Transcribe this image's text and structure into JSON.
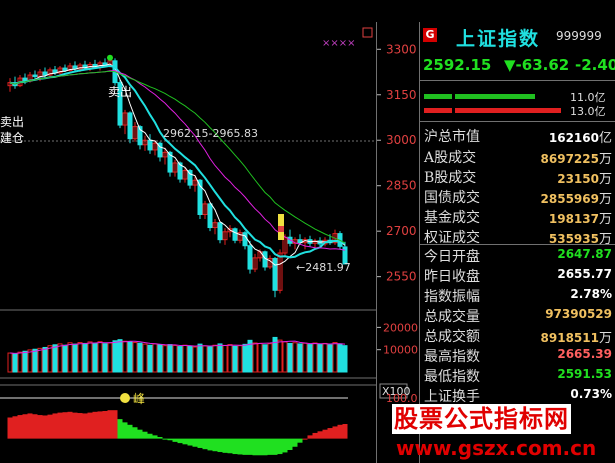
{
  "header": {
    "badge": "G",
    "index_name": "上证指数",
    "index_code": "999999"
  },
  "quote": {
    "last": "2592.15",
    "change": "▼-63.62",
    "change_pct": "-2.40"
  },
  "volume_bars": {
    "upper_label": "11.0亿",
    "lower_label": "13.0亿"
  },
  "stats": [
    {
      "key": "沪总市值",
      "value": "162160",
      "unit": "亿",
      "color": "#ffffff"
    },
    {
      "key": "A股成交",
      "value": "8697225",
      "unit": "万",
      "color": "#f0c060"
    },
    {
      "key": "B股成交",
      "value": "23150",
      "unit": "万",
      "color": "#f0c060"
    },
    {
      "key": "国债成交",
      "value": "2855969",
      "unit": "万",
      "color": "#f0c060"
    },
    {
      "key": "基金成交",
      "value": "198137",
      "unit": "万",
      "color": "#f0c060"
    },
    {
      "key": "权证成交",
      "value": "535935",
      "unit": "万",
      "color": "#f0c060"
    },
    {
      "key": "今日开盘",
      "value": "2647.87",
      "unit": "",
      "color": "#20e020"
    },
    {
      "key": "昨日收盘",
      "value": "2655.77",
      "unit": "",
      "color": "#ffffff"
    },
    {
      "key": "指数振幅",
      "value": "2.78%",
      "unit": "",
      "color": "#ffffff"
    },
    {
      "key": "总成交量",
      "value": "97390529",
      "unit": "",
      "color": "#f0c060"
    },
    {
      "key": "总成交额",
      "value": "8918511",
      "unit": "万",
      "color": "#f0c060"
    },
    {
      "key": "最高指数",
      "value": "2665.39",
      "unit": "",
      "color": "#ff6060"
    },
    {
      "key": "最低指数",
      "value": "2591.53",
      "unit": "",
      "color": "#20e020"
    },
    {
      "key": "上证换手",
      "value": "0.73%",
      "unit": "",
      "color": "#ffffff"
    }
  ],
  "price_axis": {
    "range": [
      2440,
      3390
    ],
    "ticks": [
      "3300",
      "3150",
      "3000",
      "2850",
      "2700",
      "2550"
    ]
  },
  "volume_axis": {
    "ticks": [
      "20000",
      "10000"
    ],
    "multiplier": "X100"
  },
  "indicator_axis": {
    "ticks": [
      "100.0"
    ]
  },
  "annotations": {
    "buy": "建仓",
    "sell": "卖出",
    "range": "2962.15-2965.83",
    "low": "←2481.97",
    "peak": "峰"
  },
  "watermark": {
    "title": "股票公式指标网",
    "url": "www.gszx.com.cn"
  },
  "colors": {
    "up": "#e02020",
    "down": "#20e0e0",
    "accent_green": "#20e020",
    "grid": "#707070"
  },
  "chart_data": {
    "type": "candlestick",
    "series": [
      {
        "o": 3180,
        "h": 3205,
        "l": 3160,
        "c": 3190
      },
      {
        "o": 3190,
        "h": 3210,
        "l": 3170,
        "c": 3180
      },
      {
        "o": 3180,
        "h": 3215,
        "l": 3175,
        "c": 3205
      },
      {
        "o": 3205,
        "h": 3220,
        "l": 3185,
        "c": 3195
      },
      {
        "o": 3195,
        "h": 3225,
        "l": 3190,
        "c": 3215
      },
      {
        "o": 3215,
        "h": 3230,
        "l": 3200,
        "c": 3210
      },
      {
        "o": 3210,
        "h": 3235,
        "l": 3195,
        "c": 3225
      },
      {
        "o": 3225,
        "h": 3240,
        "l": 3205,
        "c": 3215
      },
      {
        "o": 3215,
        "h": 3240,
        "l": 3210,
        "c": 3232
      },
      {
        "o": 3232,
        "h": 3245,
        "l": 3215,
        "c": 3222
      },
      {
        "o": 3222,
        "h": 3245,
        "l": 3210,
        "c": 3238
      },
      {
        "o": 3238,
        "h": 3250,
        "l": 3225,
        "c": 3230
      },
      {
        "o": 3230,
        "h": 3255,
        "l": 3220,
        "c": 3245
      },
      {
        "o": 3245,
        "h": 3260,
        "l": 3225,
        "c": 3235
      },
      {
        "o": 3235,
        "h": 3255,
        "l": 3225,
        "c": 3248
      },
      {
        "o": 3248,
        "h": 3262,
        "l": 3230,
        "c": 3238
      },
      {
        "o": 3238,
        "h": 3258,
        "l": 3228,
        "c": 3250
      },
      {
        "o": 3250,
        "h": 3265,
        "l": 3235,
        "c": 3242
      },
      {
        "o": 3242,
        "h": 3262,
        "l": 3230,
        "c": 3255
      },
      {
        "o": 3255,
        "h": 3270,
        "l": 3240,
        "c": 3248
      },
      {
        "o": 3248,
        "h": 3268,
        "l": 3240,
        "c": 3262
      },
      {
        "o": 3262,
        "h": 3270,
        "l": 3180,
        "c": 3190
      },
      {
        "o": 3190,
        "h": 3200,
        "l": 3040,
        "c": 3050
      },
      {
        "o": 3050,
        "h": 3100,
        "l": 3020,
        "c": 3090
      },
      {
        "o": 3090,
        "h": 3095,
        "l": 2990,
        "c": 3005
      },
      {
        "o": 3005,
        "h": 3060,
        "l": 2995,
        "c": 3045
      },
      {
        "o": 3045,
        "h": 3050,
        "l": 2970,
        "c": 2985
      },
      {
        "o": 2985,
        "h": 3015,
        "l": 2965,
        "c": 3000
      },
      {
        "o": 3000,
        "h": 3020,
        "l": 2955,
        "c": 2968
      },
      {
        "o": 2968,
        "h": 3000,
        "l": 2950,
        "c": 2990
      },
      {
        "o": 2990,
        "h": 2995,
        "l": 2930,
        "c": 2945
      },
      {
        "o": 2945,
        "h": 2975,
        "l": 2920,
        "c": 2960
      },
      {
        "o": 2960,
        "h": 2965,
        "l": 2880,
        "c": 2895
      },
      {
        "o": 2895,
        "h": 2935,
        "l": 2880,
        "c": 2925
      },
      {
        "o": 2925,
        "h": 2930,
        "l": 2860,
        "c": 2872
      },
      {
        "o": 2872,
        "h": 2910,
        "l": 2860,
        "c": 2900
      },
      {
        "o": 2900,
        "h": 2905,
        "l": 2840,
        "c": 2852
      },
      {
        "o": 2852,
        "h": 2880,
        "l": 2830,
        "c": 2868
      },
      {
        "o": 2868,
        "h": 2872,
        "l": 2740,
        "c": 2755
      },
      {
        "o": 2755,
        "h": 2800,
        "l": 2740,
        "c": 2790
      },
      {
        "o": 2790,
        "h": 2795,
        "l": 2700,
        "c": 2712
      },
      {
        "o": 2712,
        "h": 2740,
        "l": 2690,
        "c": 2728
      },
      {
        "o": 2728,
        "h": 2732,
        "l": 2660,
        "c": 2672
      },
      {
        "o": 2672,
        "h": 2710,
        "l": 2655,
        "c": 2698
      },
      {
        "o": 2698,
        "h": 2720,
        "l": 2680,
        "c": 2708
      },
      {
        "o": 2708,
        "h": 2712,
        "l": 2660,
        "c": 2670
      },
      {
        "o": 2670,
        "h": 2705,
        "l": 2660,
        "c": 2695
      },
      {
        "o": 2695,
        "h": 2700,
        "l": 2640,
        "c": 2652
      },
      {
        "o": 2652,
        "h": 2668,
        "l": 2560,
        "c": 2575
      },
      {
        "o": 2575,
        "h": 2625,
        "l": 2565,
        "c": 2612
      },
      {
        "o": 2612,
        "h": 2640,
        "l": 2600,
        "c": 2632
      },
      {
        "o": 2632,
        "h": 2636,
        "l": 2570,
        "c": 2582
      },
      {
        "o": 2582,
        "h": 2620,
        "l": 2575,
        "c": 2610
      },
      {
        "o": 2610,
        "h": 2615,
        "l": 2482,
        "c": 2505
      },
      {
        "o": 2505,
        "h": 2640,
        "l": 2495,
        "c": 2628
      },
      {
        "o": 2628,
        "h": 2690,
        "l": 2615,
        "c": 2680
      },
      {
        "o": 2680,
        "h": 2705,
        "l": 2650,
        "c": 2660
      },
      {
        "o": 2660,
        "h": 2680,
        "l": 2640,
        "c": 2672
      },
      {
        "o": 2672,
        "h": 2690,
        "l": 2655,
        "c": 2662
      },
      {
        "o": 2662,
        "h": 2680,
        "l": 2640,
        "c": 2672
      },
      {
        "o": 2672,
        "h": 2685,
        "l": 2650,
        "c": 2660
      },
      {
        "o": 2660,
        "h": 2675,
        "l": 2645,
        "c": 2668
      },
      {
        "o": 2668,
        "h": 2680,
        "l": 2650,
        "c": 2658
      },
      {
        "o": 2658,
        "h": 2680,
        "l": 2650,
        "c": 2670
      },
      {
        "o": 2670,
        "h": 2690,
        "l": 2655,
        "c": 2662
      },
      {
        "o": 2662,
        "h": 2705,
        "l": 2655,
        "c": 2692
      },
      {
        "o": 2692,
        "h": 2700,
        "l": 2640,
        "c": 2650
      },
      {
        "o": 2648,
        "h": 2665,
        "l": 2592,
        "c": 2592
      }
    ],
    "volume": [
      8500,
      8200,
      8900,
      9300,
      9900,
      10200,
      10600,
      11000,
      11800,
      12200,
      12600,
      12000,
      13100,
      12500,
      13200,
      12800,
      13500,
      13000,
      13600,
      12700,
      13000,
      14000,
      14500,
      13800,
      13600,
      13200,
      12900,
      12500,
      12000,
      12600,
      12100,
      11800,
      12300,
      11900,
      11400,
      12000,
      11600,
      11200,
      12500,
      11700,
      11300,
      12000,
      12600,
      11900,
      12300,
      11500,
      11800,
      12400,
      14200,
      13000,
      12800,
      12200,
      12700,
      15500,
      14300,
      13500,
      12800,
      13100,
      12600,
      12900,
      12300,
      13000,
      12500,
      12800,
      12200,
      13200,
      12600,
      11800
    ],
    "volume_range": [
      0,
      26000
    ],
    "indicator": [
      52,
      55,
      58,
      60,
      62,
      60,
      58,
      57,
      59,
      62,
      64,
      65,
      66,
      64,
      63,
      62,
      64,
      66,
      67,
      68,
      70,
      70,
      48,
      40,
      34,
      28,
      22,
      17,
      12,
      8,
      4,
      0,
      -4,
      -8,
      -11,
      -14,
      -17,
      -20,
      -23,
      -26,
      -29,
      -31,
      -33,
      -35,
      -36,
      -38,
      -39,
      -40,
      -40,
      -41,
      -41,
      -41,
      -40,
      -40,
      -38,
      -34,
      -28,
      -20,
      -10,
      0,
      8,
      14,
      18,
      22,
      26,
      30,
      34,
      36
    ],
    "indicator_range": [
      -60,
      100
    ]
  }
}
